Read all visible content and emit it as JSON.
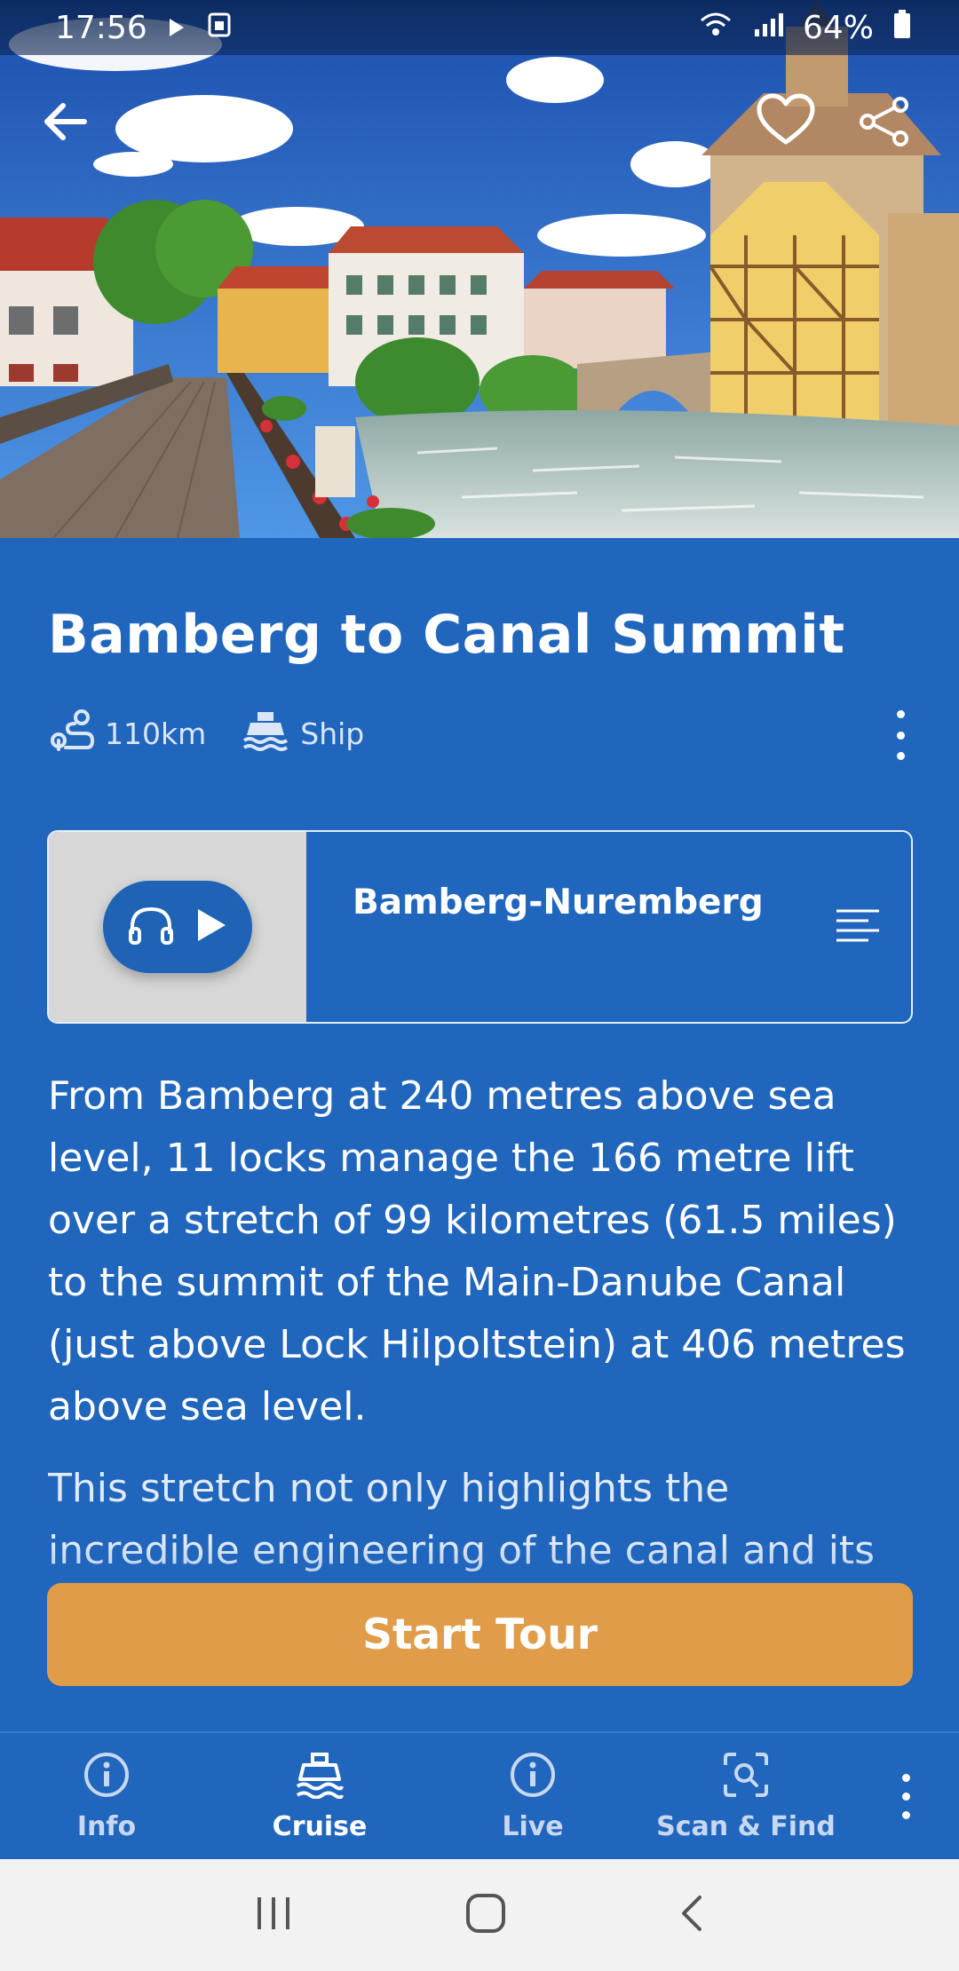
{
  "status_bar": {
    "time": "17:56",
    "battery": "64%",
    "icons": [
      "play-icon",
      "sim-icon",
      "wifi-icon",
      "signal-icon",
      "battery-icon"
    ]
  },
  "hero": {
    "back_icon": "arrow-left-icon",
    "favorite_icon": "heart-icon",
    "share_icon": "share-icon"
  },
  "tour": {
    "title": "Bamberg to Canal Summit",
    "distance": "110km",
    "transport": "Ship"
  },
  "audio": {
    "track_title": "Bamberg-Nuremberg"
  },
  "description": {
    "paragraph1": "From Bamberg at 240 metres above sea level, 11 locks manage the 166 metre lift over a stretch of 99 kilometres (61.5 miles) to the summit of the Main-Danube Canal (just above Lock Hilpoltstein) at 406 metres above sea level.",
    "paragraph2": "This stretch not only highlights the incredible engineering of the canal and its predecessors,"
  },
  "start_button": "Start Tour",
  "bottom_nav": {
    "items": [
      {
        "label": "Info",
        "icon": "info-icon"
      },
      {
        "label": "Cruise",
        "icon": "ship-icon"
      },
      {
        "label": "Live",
        "icon": "info-icon"
      },
      {
        "label": "Scan & Find",
        "icon": "scan-icon"
      }
    ],
    "active": "Cruise"
  },
  "colors": {
    "primary": "#2166bd",
    "accent": "#e09c48"
  }
}
